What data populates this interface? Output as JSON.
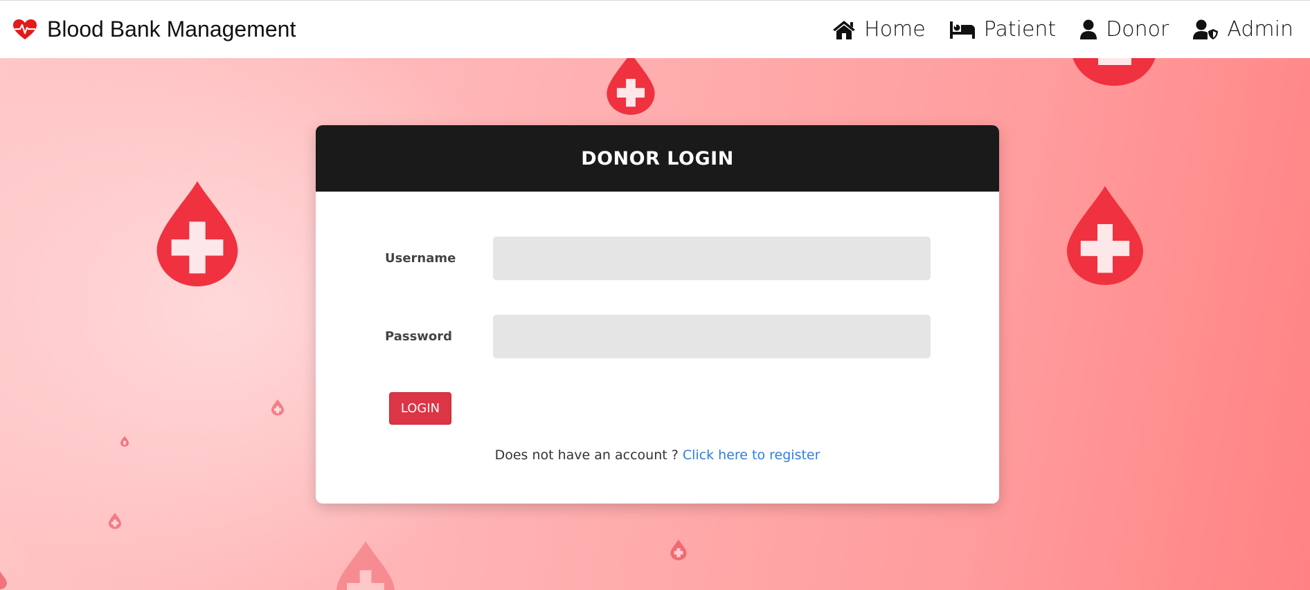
{
  "navbar": {
    "brand_title": "Blood Bank Management",
    "brand_icon": "heartbeat-icon",
    "items": [
      {
        "label": "Home",
        "icon": "home-icon"
      },
      {
        "label": "Patient",
        "icon": "bed-icon"
      },
      {
        "label": "Donor",
        "icon": "user-icon"
      },
      {
        "label": "Admin",
        "icon": "user-shield-icon"
      }
    ]
  },
  "login_card": {
    "title": "DONOR LOGIN",
    "username_label": "Username",
    "username_value": "",
    "password_label": "Password",
    "password_value": "",
    "login_button": "LOGIN",
    "register_prompt": "Does not have an account ? ",
    "register_link": "Click here to register"
  },
  "colors": {
    "accent_red": "#dc3545",
    "header_dark": "#1a1a1a",
    "link_blue": "#2f7de1",
    "drop_red": "#f0313f"
  }
}
